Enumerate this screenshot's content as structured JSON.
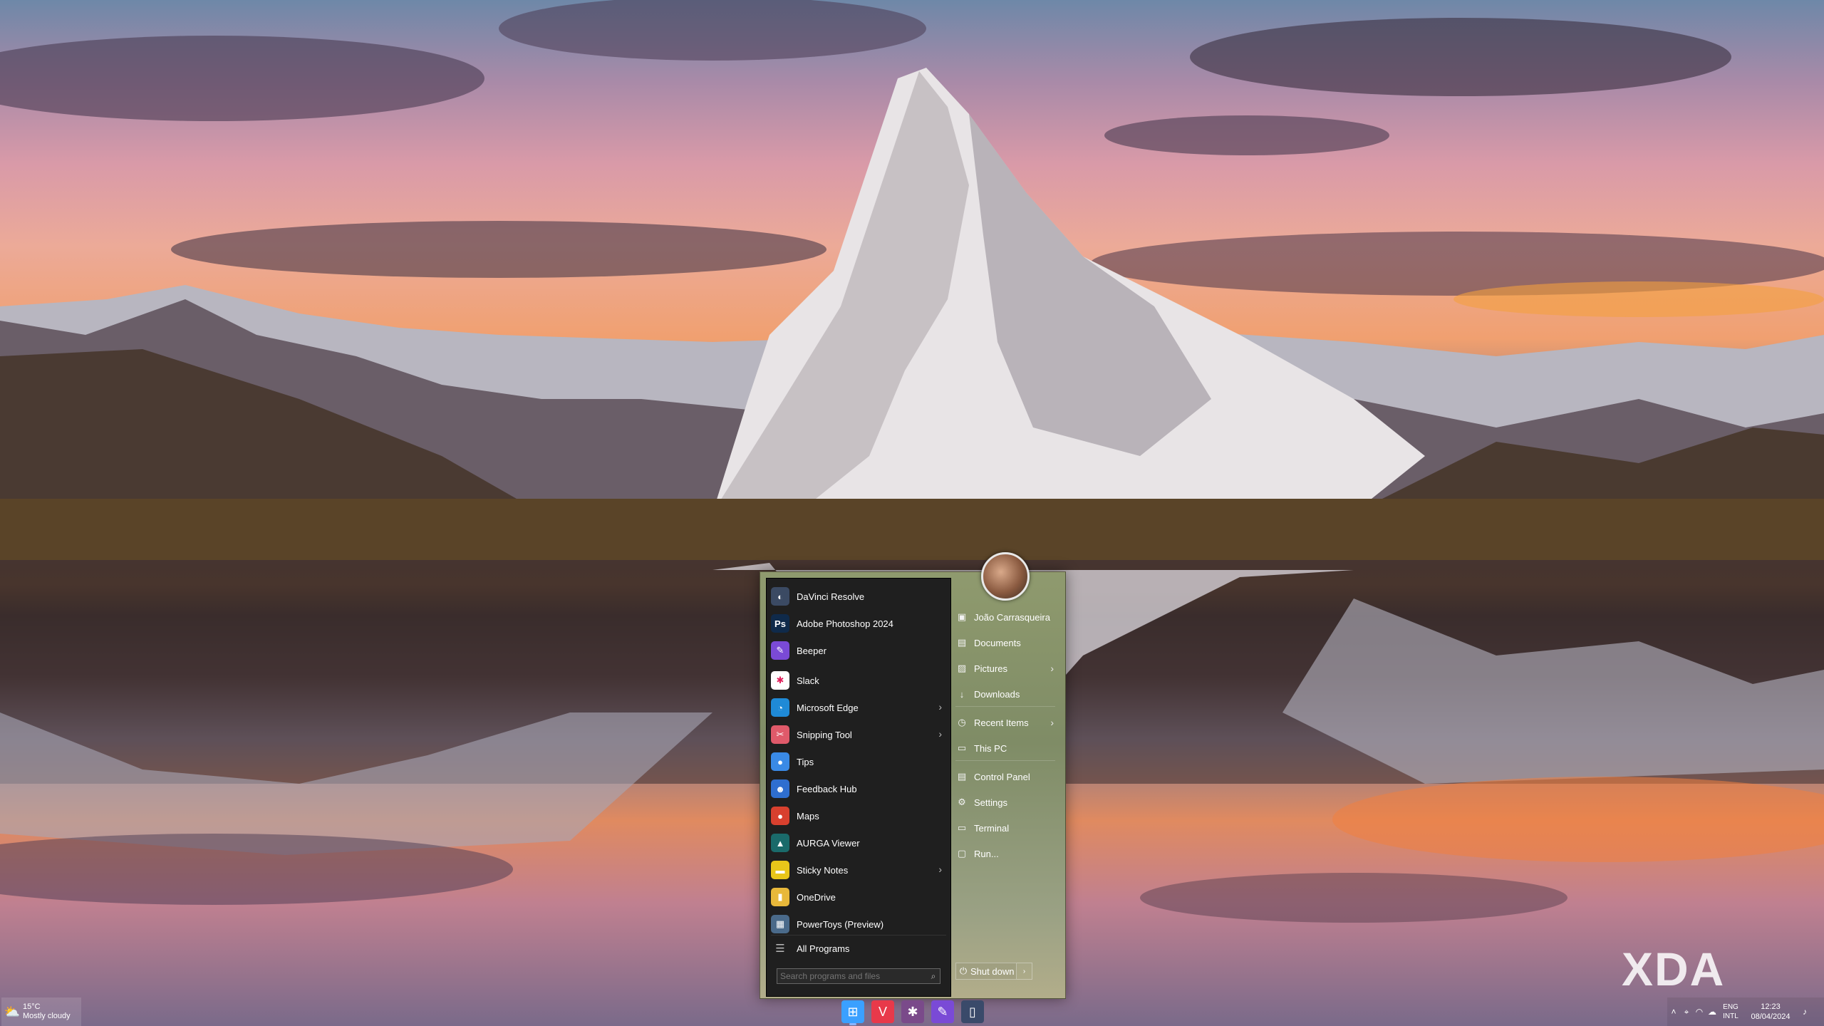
{
  "start_menu": {
    "programs": [
      {
        "label": "DaVinci Resolve",
        "icon": "davinci-resolve-icon",
        "glyph": "◐",
        "color": "#3b4a63",
        "has_submenu": false
      },
      {
        "label": "Adobe Photoshop 2024",
        "icon": "photoshop-icon",
        "glyph": "Ps",
        "color": "#0f2a4a",
        "has_submenu": false
      },
      {
        "label": "Beeper",
        "icon": "beeper-icon",
        "glyph": "✎",
        "color": "#7a4ad6",
        "has_submenu": false
      },
      {
        "label": "Slack",
        "icon": "slack-icon",
        "glyph": "✱",
        "color": "#ffffff",
        "has_submenu": false
      },
      {
        "label": "Microsoft Edge",
        "icon": "edge-icon",
        "glyph": "◔",
        "color": "#1f8ad6",
        "has_submenu": true
      },
      {
        "label": "Snipping Tool",
        "icon": "snipping-tool-icon",
        "glyph": "✂",
        "color": "#e05a6a",
        "has_submenu": true
      },
      {
        "label": "Tips",
        "icon": "tips-icon",
        "glyph": "●",
        "color": "#3a8ae6",
        "has_submenu": false
      },
      {
        "label": "Feedback Hub",
        "icon": "feedback-hub-icon",
        "glyph": "☻",
        "color": "#2e6ecf",
        "has_submenu": false
      },
      {
        "label": "Maps",
        "icon": "maps-icon",
        "glyph": "●",
        "color": "#d8402e",
        "has_submenu": false
      },
      {
        "label": "AURGA Viewer",
        "icon": "aurga-viewer-icon",
        "glyph": "▲",
        "color": "#1a6a6a",
        "has_submenu": false
      },
      {
        "label": "Sticky Notes",
        "icon": "sticky-notes-icon",
        "glyph": "▬",
        "color": "#e8c61a",
        "has_submenu": true
      },
      {
        "label": "OneDrive",
        "icon": "onedrive-icon",
        "glyph": "▮",
        "color": "#e8b83a",
        "has_submenu": false
      },
      {
        "label": "PowerToys (Preview)",
        "icon": "powertoys-icon",
        "glyph": "▦",
        "color": "#4a6a8a",
        "has_submenu": false
      }
    ],
    "all_programs_label": "All Programs",
    "search_placeholder": "Search programs and files",
    "right_items": [
      {
        "label": "João Carrasqueira",
        "icon": "user-folder-icon",
        "glyph": "▣",
        "has_submenu": false
      },
      {
        "label": "Documents",
        "icon": "documents-icon",
        "glyph": "▤",
        "has_submenu": false
      },
      {
        "label": "Pictures",
        "icon": "pictures-icon",
        "glyph": "▨",
        "has_submenu": true
      },
      {
        "label": "Downloads",
        "icon": "downloads-icon",
        "glyph": "↓",
        "has_submenu": false
      },
      {
        "label": "Recent Items",
        "icon": "recent-items-icon",
        "glyph": "◷",
        "has_submenu": true
      },
      {
        "label": "This PC",
        "icon": "this-pc-icon",
        "glyph": "▭",
        "has_submenu": false
      },
      {
        "label": "Control Panel",
        "icon": "control-panel-icon",
        "glyph": "▤",
        "has_submenu": false
      },
      {
        "label": "Settings",
        "icon": "settings-icon",
        "glyph": "⚙",
        "has_submenu": false
      },
      {
        "label": "Terminal",
        "icon": "terminal-icon",
        "glyph": "▭",
        "has_submenu": false
      },
      {
        "label": "Run...",
        "icon": "run-icon",
        "glyph": "▢",
        "has_submenu": false
      }
    ],
    "shutdown_label": "Shut down"
  },
  "taskbar": {
    "weather": {
      "temperature": "15°C",
      "condition": "Mostly cloudy"
    },
    "apps": [
      {
        "name": "start-button",
        "glyph": "⊞",
        "color": "#3aa0ff"
      },
      {
        "name": "vivaldi-icon",
        "glyph": "V",
        "color": "#e8394a"
      },
      {
        "name": "slack-taskbar-icon",
        "glyph": "✱",
        "color": "#7a4a8a"
      },
      {
        "name": "beeper-taskbar-icon",
        "glyph": "✎",
        "color": "#7a4ad6"
      },
      {
        "name": "open-shell-icon",
        "glyph": "▯",
        "color": "#3a4a6a"
      }
    ],
    "tray": {
      "language_line1": "ENG",
      "language_line2": "INTL",
      "time": "12:23",
      "date": "08/04/2024"
    }
  },
  "watermark": "XDA"
}
